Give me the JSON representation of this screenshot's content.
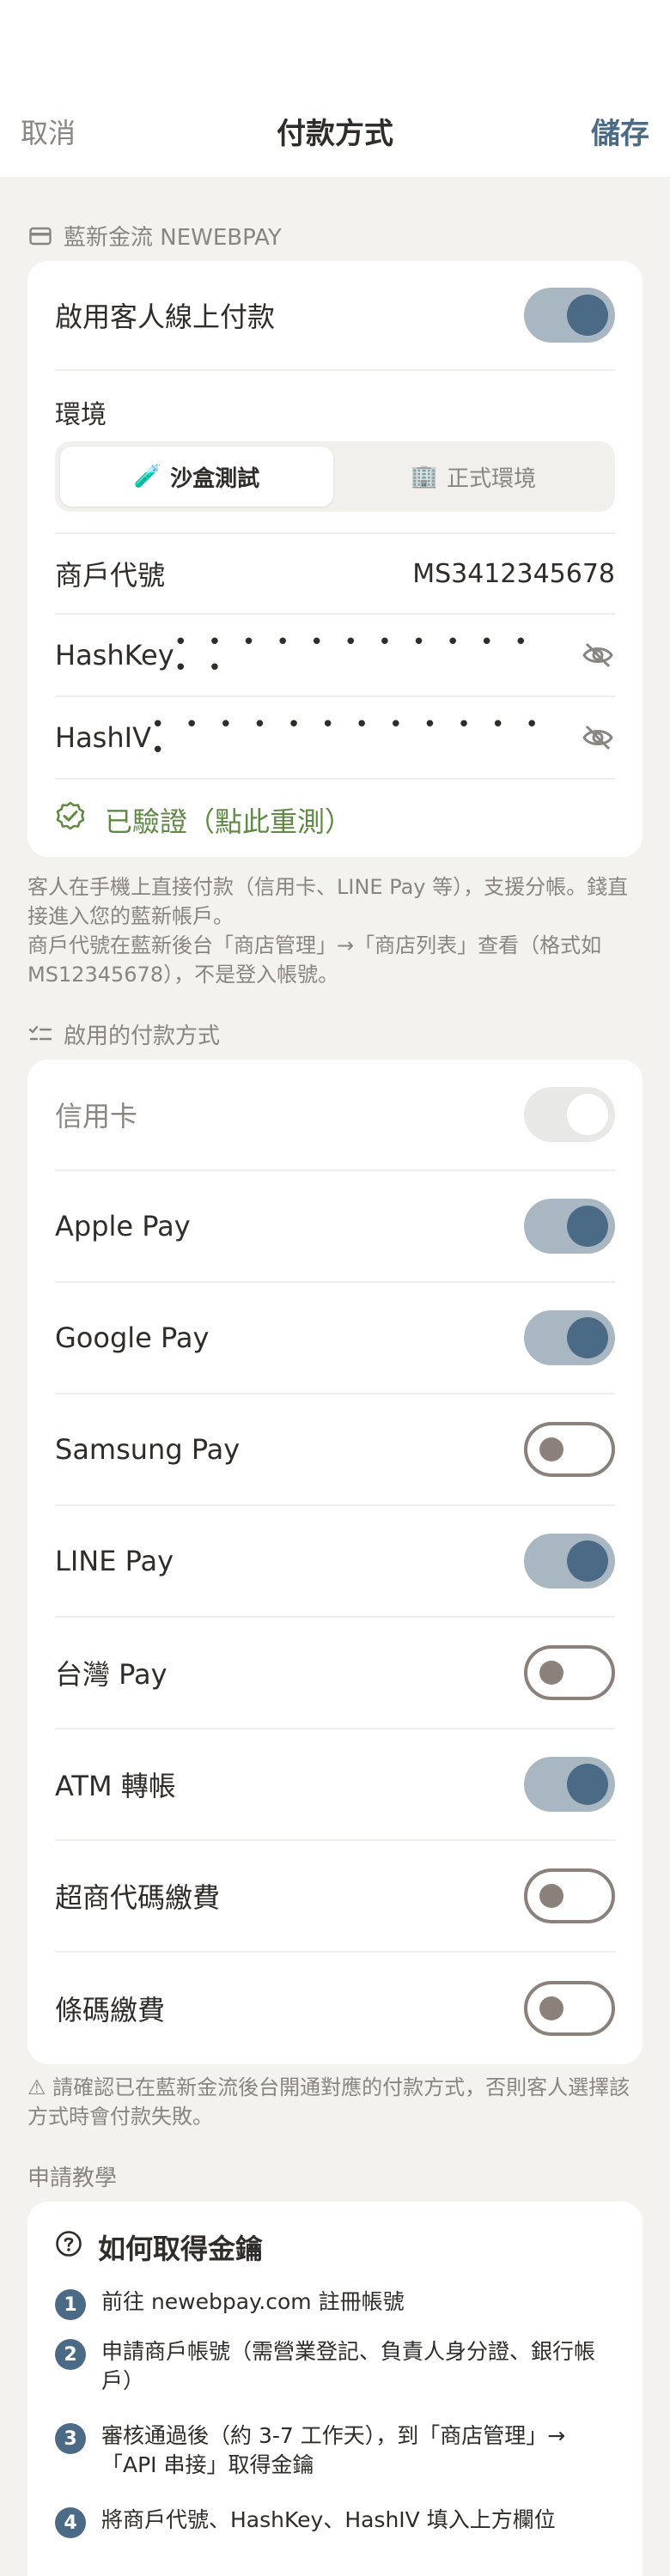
{
  "header": {
    "cancel": "取消",
    "title": "付款方式",
    "save": "儲存"
  },
  "newebpay": {
    "section_label": "藍新金流 NEWEBPAY",
    "enable_label": "啟用客人線上付款",
    "enable_on": true,
    "env_label": "環境",
    "env_options": [
      {
        "icon": "🧪",
        "label": "沙盒測試",
        "active": true
      },
      {
        "icon": "🏢",
        "label": "正式環境",
        "active": false
      }
    ],
    "merchant_label": "商戶代號",
    "merchant_value": "MS3412345678",
    "hashkey_label": "HashKey",
    "hashkey_mask": "• • • • • • • • • • • • •",
    "hashiv_label": "HashIV",
    "hashiv_mask": "• • • • • • • • • • • • •",
    "verified_text": "已驗證（點此重測）",
    "note_line1": "客人在手機上直接付款（信用卡、LINE Pay 等），支援分帳。錢直接進入您的藍新帳戶。",
    "note_line2": "商戶代號在藍新後台「商店管理」→「商店列表」查看（格式如 MS12345678），不是登入帳號。"
  },
  "methods": {
    "section_label": "啟用的付款方式",
    "items": [
      {
        "label": "信用卡",
        "state": "disabled"
      },
      {
        "label": "Apple Pay",
        "state": "on"
      },
      {
        "label": "Google Pay",
        "state": "on"
      },
      {
        "label": "Samsung Pay",
        "state": "off"
      },
      {
        "label": "LINE Pay",
        "state": "on"
      },
      {
        "label": "台灣 Pay",
        "state": "off"
      },
      {
        "label": "ATM 轉帳",
        "state": "on"
      },
      {
        "label": "超商代碼繳費",
        "state": "off"
      },
      {
        "label": "條碼繳費",
        "state": "off"
      }
    ],
    "warning": "⚠ 請確認已在藍新金流後台開通對應的付款方式，否則客人選擇該方式時會付款失敗。"
  },
  "guide": {
    "section_label": "申請教學",
    "title": "如何取得金鑰",
    "steps": [
      {
        "num": "1",
        "text": "前往 newebpay.com 註冊帳號"
      },
      {
        "num": "2",
        "text": "申請商戶帳號（需營業登記、負責人身分證、銀行帳戶）"
      },
      {
        "num": "3",
        "text": "審核通過後（約 3-7 工作天），到「商店管理」→「API 串接」取得金鑰"
      },
      {
        "num": "4",
        "text": "將商戶代號、HashKey、HashIV 填入上方欄位"
      }
    ]
  },
  "colors": {
    "accent": "#4b6a86",
    "success": "#5f8a44",
    "muted": "#8a8580",
    "background": "#f3f2ef"
  }
}
